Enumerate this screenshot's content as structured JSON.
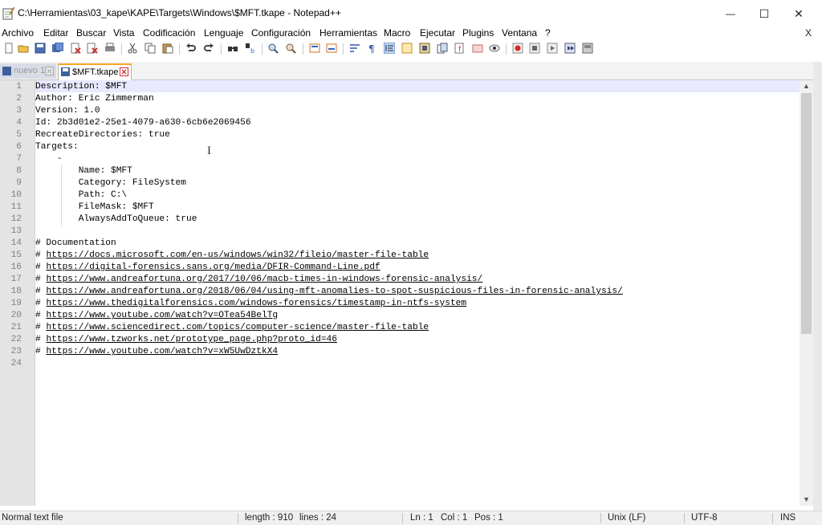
{
  "window": {
    "title": "C:\\Herramientas\\03_kape\\KAPE\\Targets\\Windows\\$MFT.tkape - Notepad++",
    "minimize_glyph": "—",
    "maximize_glyph": "☐",
    "close_glyph": "✕"
  },
  "menu": {
    "items": [
      "Archivo",
      "Editar",
      "Buscar",
      "Vista",
      "Codificación",
      "Lenguaje",
      "Configuración",
      "Herramientas",
      "Macro",
      "Ejecutar",
      "Plugins",
      "Ventana",
      "?"
    ],
    "close_doc": "X"
  },
  "toolbar": {
    "icons": [
      "new-file-icon",
      "open-file-icon",
      "save-icon",
      "save-all-icon",
      "close-icon",
      "close-all-icon",
      "print-icon",
      "cut-icon",
      "copy-icon",
      "paste-icon",
      "undo-icon",
      "redo-icon",
      "find-icon",
      "replace-icon",
      "zoom-in-icon",
      "zoom-out-icon",
      "sync-vertical-icon",
      "sync-horizontal-icon",
      "word-wrap-icon",
      "show-all-characters-icon",
      "indent-guide-icon",
      "user-defined-language-icon",
      "document-map-icon",
      "function-list-icon",
      "folder-workspace-icon",
      "monitoring-icon",
      "record-macro-icon",
      "stop-record-icon",
      "playback-macro-icon",
      "run-macro-multiple-icon",
      "save-macro-icon",
      "spell-check-icon"
    ]
  },
  "tabs": [
    {
      "label": "nuevo 1",
      "active": false
    },
    {
      "label": "$MFT.tkape",
      "active": true
    }
  ],
  "editor": {
    "lines": [
      {
        "n": "1",
        "text": "Description: $MFT"
      },
      {
        "n": "2",
        "text": "Author: Eric Zimmerman"
      },
      {
        "n": "3",
        "text": "Version: 1.0"
      },
      {
        "n": "4",
        "text": "Id: 2b3d01e2-25e1-4079-a630-6cb6e2069456"
      },
      {
        "n": "5",
        "text": "RecreateDirectories: true"
      },
      {
        "n": "6",
        "text": "Targets:"
      },
      {
        "n": "7",
        "text": "    -"
      },
      {
        "n": "8",
        "text": "        Name: $MFT"
      },
      {
        "n": "9",
        "text": "        Category: FileSystem"
      },
      {
        "n": "10",
        "text": "        Path: C:\\"
      },
      {
        "n": "11",
        "text": "        FileMask: $MFT"
      },
      {
        "n": "12",
        "text": "        AlwaysAddToQueue: true"
      },
      {
        "n": "13",
        "text": ""
      },
      {
        "n": "14",
        "text": "# Documentation"
      },
      {
        "n": "15",
        "text": "# ",
        "link": "https://docs.microsoft.com/en-us/windows/win32/fileio/master-file-table"
      },
      {
        "n": "16",
        "text": "# ",
        "link": "https://digital-forensics.sans.org/media/DFIR-Command-Line.pdf"
      },
      {
        "n": "17",
        "text": "# ",
        "link": "https://www.andreafortuna.org/2017/10/06/macb-times-in-windows-forensic-analysis/"
      },
      {
        "n": "18",
        "text": "# ",
        "link": "https://www.andreafortuna.org/2018/06/04/using-mft-anomalies-to-spot-suspicious-files-in-forensic-analysis/"
      },
      {
        "n": "19",
        "text": "# ",
        "link": "https://www.thedigitalforensics.com/windows-forensics/timestamp-in-ntfs-system"
      },
      {
        "n": "20",
        "text": "# ",
        "link": "https://www.youtube.com/watch?v=OTea54BelTg"
      },
      {
        "n": "21",
        "text": "# ",
        "link": "https://www.sciencedirect.com/topics/computer-science/master-file-table"
      },
      {
        "n": "22",
        "text": "# ",
        "link": "https://www.tzworks.net/prototype_page.php?proto_id=46"
      },
      {
        "n": "23",
        "text": "# ",
        "link": "https://www.youtube.com/watch?v=xW5UwDztkX4"
      },
      {
        "n": "24",
        "text": ""
      }
    ]
  },
  "status": {
    "type": "Normal text file",
    "length": "length : 910",
    "lines": "lines : 24",
    "ln": "Ln : 1",
    "col": "Col : 1",
    "pos": "Pos : 1",
    "eol": "Unix (LF)",
    "encoding": "UTF-8",
    "mode": "INS"
  },
  "colors": {
    "current_line": "#e8e8ff",
    "gutter": "#e4e4e4",
    "tab_accent": "#f5a623"
  }
}
